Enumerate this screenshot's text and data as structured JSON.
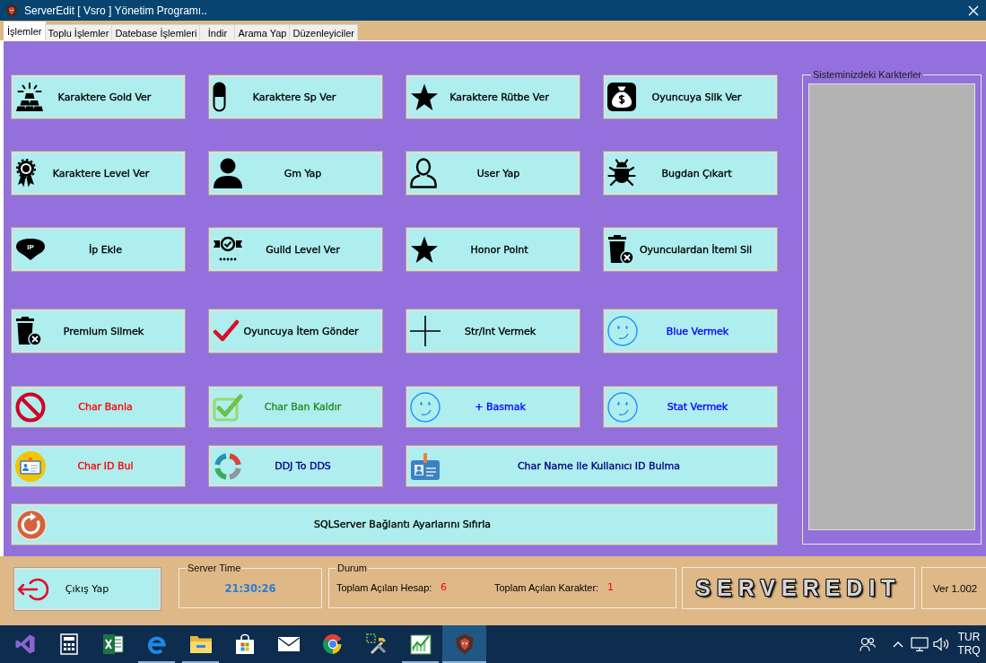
{
  "window": {
    "title": "ServerEdit [ Vsro ] Yönetim Programı.."
  },
  "tabs": [
    {
      "label": "İşlemler",
      "selected": true
    },
    {
      "label": "Toplu İşlemler",
      "selected": false
    },
    {
      "label": "Datebase İşlemleri",
      "selected": false
    },
    {
      "label": "İndir",
      "selected": false
    },
    {
      "label": "Arama Yap",
      "selected": false
    },
    {
      "label": "Düzenleyiciler",
      "selected": false
    }
  ],
  "actions": {
    "rows": [
      [
        {
          "label": "Karaktere Gold Ver",
          "color": "#000000"
        },
        {
          "label": "Karaktere Sp Ver",
          "color": "#000000"
        },
        {
          "label": "Karaktere Rütbe Ver",
          "color": "#000000"
        },
        {
          "label": "Oyuncuya Silk Ver",
          "color": "#000000"
        }
      ],
      [
        {
          "label": "Karaktere Level Ver",
          "color": "#000000"
        },
        {
          "label": "Gm Yap",
          "color": "#000000"
        },
        {
          "label": "User Yap",
          "color": "#000000"
        },
        {
          "label": "Bugdan Çıkart",
          "color": "#000000"
        }
      ],
      [
        {
          "label": "İp Ekle",
          "color": "#000000",
          "icon_text": "IP"
        },
        {
          "label": "Guild Level Ver",
          "color": "#000000"
        },
        {
          "label": "Honor Point",
          "color": "#000000"
        },
        {
          "label": "Oyunculardan İtemi Sil",
          "color": "#000000"
        }
      ],
      [
        {
          "label": "Premium Silmek",
          "color": "#000000"
        },
        {
          "label": "Oyuncuya İtem Gönder",
          "color": "#000000"
        },
        {
          "label": "Str/Int Vermek",
          "color": "#000000"
        },
        {
          "label": "Blue Vermek",
          "color": "#0000ff"
        }
      ],
      [
        {
          "label": "Char Banla",
          "color": "#ff0000"
        },
        {
          "label": "Char Ban Kaldır",
          "color": "#228b22"
        },
        {
          "label": "+ Basmak",
          "color": "#0000ff"
        },
        {
          "label": "Stat Vermek",
          "color": "#0000ff"
        }
      ],
      [
        {
          "label": "Char ID Bul",
          "color": "#ff0000"
        },
        {
          "label": "DDJ To DDS",
          "color": "#000080"
        },
        {
          "label": "Char Name ile Kullanıcı ID Bulma",
          "color": "#000080"
        }
      ],
      [
        {
          "label": "SQLServer Bağlantı Ayarlarını Sıfırla",
          "color": "#000000"
        }
      ]
    ]
  },
  "characters_panel": {
    "title": "Sisteminizdeki Karkterler"
  },
  "footer": {
    "exit_button": {
      "label": "Çıkış Yap"
    },
    "server_time": {
      "title": "Server Time",
      "value": "21:30:26"
    },
    "status": {
      "title": "Durum",
      "items": [
        {
          "label": "Toplam Açılan Hesap:",
          "value": "6"
        },
        {
          "label": "Toplam Açılan Karakter:",
          "value": "1"
        }
      ]
    },
    "logo": "SERVEREDIT",
    "version": "Ver 1.002"
  },
  "taskbar": {
    "apps": [
      {
        "running": false,
        "selected": false
      },
      {
        "running": false,
        "selected": false
      },
      {
        "running": false,
        "selected": false
      },
      {
        "running": true,
        "selected": false
      },
      {
        "running": true,
        "selected": false
      },
      {
        "running": false,
        "selected": false
      },
      {
        "running": false,
        "selected": false
      },
      {
        "running": false,
        "selected": false
      },
      {
        "running": false,
        "selected": false
      },
      {
        "running": true,
        "selected": false
      },
      {
        "running": true,
        "selected": true
      }
    ],
    "language": {
      "code": "TUR",
      "layout": "TRQ"
    }
  }
}
